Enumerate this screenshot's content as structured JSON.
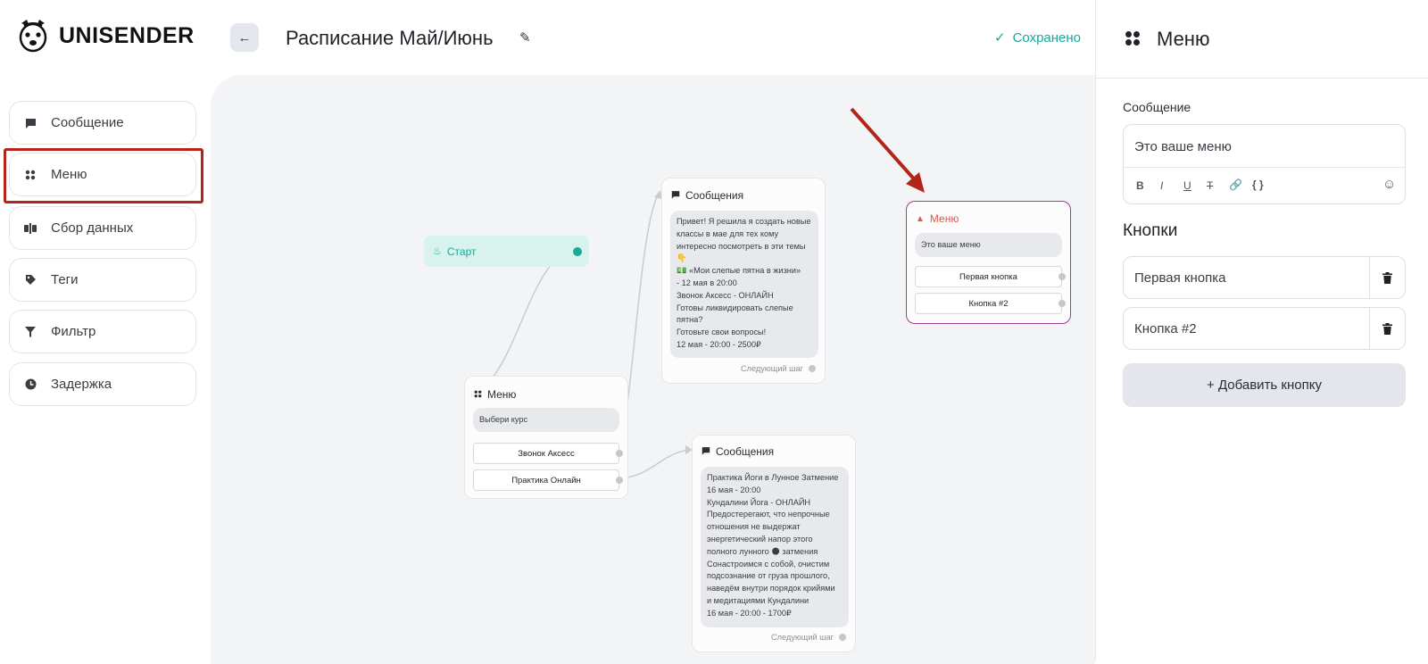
{
  "header": {
    "logo_text": "UNISENDER",
    "back_label": "←",
    "title": "Расписание Май/Июнь",
    "saved_label": "Сохранено"
  },
  "sidebar": {
    "items": [
      {
        "label": "Сообщение",
        "icon": "chat-icon"
      },
      {
        "label": "Меню",
        "icon": "grid-icon"
      },
      {
        "label": "Сбор данных",
        "icon": "data-icon"
      },
      {
        "label": "Теги",
        "icon": "tag-icon"
      },
      {
        "label": "Фильтр",
        "icon": "filter-icon"
      },
      {
        "label": "Задержка",
        "icon": "clock-icon"
      }
    ]
  },
  "canvas": {
    "start": {
      "label": "Старт"
    },
    "menu1": {
      "title": "Меню",
      "prompt": "Выбери курс",
      "buttons": [
        "Звонок Аксесс",
        "Практика Онлайн"
      ]
    },
    "msg1": {
      "title": "Сообщения",
      "lines": [
        "Привет! Я решила я создать новые",
        "классы в мае для тех кому",
        "интересно посмотреть в эти темы",
        "👇",
        "💵 «Мои слепые пятна в жизни»",
        "- 12 мая в 20:00",
        "Звонок Аксесс - ОНЛАЙН",
        "Готовы ликвидировать слепые",
        "пятна?",
        "Готовьте свои вопросы!",
        "12 мая - 20:00 - 2500₽"
      ],
      "next_step": "Следующий шаг"
    },
    "msg2": {
      "title": "Сообщения",
      "lines": [
        "Практика Йоги в Лунное Затмение",
        "16 мая - 20:00",
        "Кундалини Йога - ОНЛАЙН",
        "Предостерегают, что непрочные",
        "отношения не выдержат",
        "энергетический напор этого",
        "полного лунного 🌑 затмения",
        "Сонастроимся с собой, очистим",
        "подсознание от груза прошлого,",
        "наведём внутри порядок крийями",
        "и медитациями Кундалини",
        "16 мая - 20:00 - 1700₽"
      ],
      "next_step": "Следующий шаг"
    },
    "menu2": {
      "title": "Меню",
      "text": "Это ваше меню",
      "buttons": [
        "Первая кнопка",
        "Кнопка #2"
      ]
    }
  },
  "panel": {
    "title": "Меню",
    "message_label": "Сообщение",
    "message_value": "Это ваше меню",
    "toolbar": [
      "B",
      "I",
      "U",
      "T",
      "🔗",
      "{ }",
      "☺"
    ],
    "buttons_label": "Кнопки",
    "buttons": [
      "Первая кнопка",
      "Кнопка #2"
    ],
    "add_button_label": "+ Добавить кнопку"
  },
  "colors": {
    "accent": "#17a99a",
    "highlight": "#b3251a",
    "warning": "#e0574c",
    "selected_border": "#9c3f8f",
    "start_bg": "#d8f3ee"
  }
}
